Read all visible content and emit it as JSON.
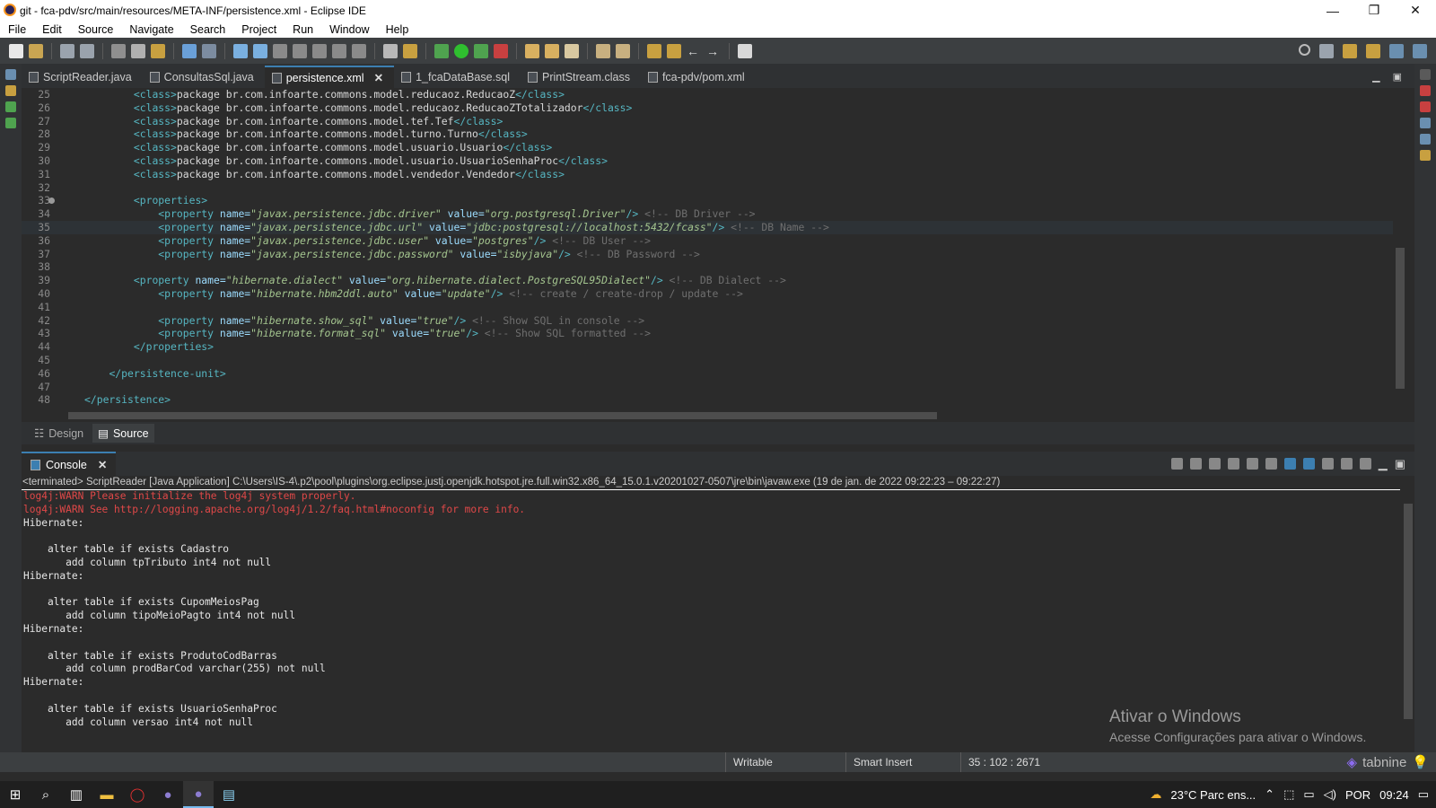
{
  "window": {
    "title": "git - fca-pdv/src/main/resources/META-INF/persistence.xml - Eclipse IDE"
  },
  "menu": [
    "File",
    "Edit",
    "Source",
    "Navigate",
    "Search",
    "Project",
    "Run",
    "Window",
    "Help"
  ],
  "editor_tabs": [
    {
      "label": "ScriptReader.java",
      "active": false
    },
    {
      "label": "ConsultasSql.java",
      "active": false
    },
    {
      "label": "persistence.xml",
      "active": true
    },
    {
      "label": "1_fcaDataBase.sql",
      "active": false
    },
    {
      "label": "PrintStream.class",
      "active": false
    },
    {
      "label": "fca-pdv/pom.xml",
      "active": false
    }
  ],
  "code_lines": [
    {
      "n": "25",
      "segs": [
        [
          "i",
          "        "
        ],
        [
          "tg",
          "<class>"
        ],
        [
          "tx",
          "package br.com.infoarte.commons.model.reducaoz.ReducaoZ"
        ],
        [
          "tg",
          "</class>"
        ]
      ]
    },
    {
      "n": "26",
      "segs": [
        [
          "i",
          "        "
        ],
        [
          "tg",
          "<class>"
        ],
        [
          "tx",
          "package br.com.infoarte.commons.model.reducaoz.ReducaoZTotalizador"
        ],
        [
          "tg",
          "</class>"
        ]
      ]
    },
    {
      "n": "27",
      "segs": [
        [
          "i",
          "        "
        ],
        [
          "tg",
          "<class>"
        ],
        [
          "tx",
          "package br.com.infoarte.commons.model.tef.Tef"
        ],
        [
          "tg",
          "</class>"
        ]
      ]
    },
    {
      "n": "28",
      "segs": [
        [
          "i",
          "        "
        ],
        [
          "tg",
          "<class>"
        ],
        [
          "tx",
          "package br.com.infoarte.commons.model.turno.Turno"
        ],
        [
          "tg",
          "</class>"
        ]
      ]
    },
    {
      "n": "29",
      "segs": [
        [
          "i",
          "        "
        ],
        [
          "tg",
          "<class>"
        ],
        [
          "tx",
          "package br.com.infoarte.commons.model.usuario.Usuario"
        ],
        [
          "tg",
          "</class>"
        ]
      ]
    },
    {
      "n": "30",
      "segs": [
        [
          "i",
          "        "
        ],
        [
          "tg",
          "<class>"
        ],
        [
          "tx",
          "package br.com.infoarte.commons.model.usuario.UsuarioSenhaProc"
        ],
        [
          "tg",
          "</class>"
        ]
      ]
    },
    {
      "n": "31",
      "segs": [
        [
          "i",
          "        "
        ],
        [
          "tg",
          "<class>"
        ],
        [
          "tx",
          "package br.com.infoarte.commons.model.vendedor.Vendedor"
        ],
        [
          "tg",
          "</class>"
        ]
      ]
    },
    {
      "n": "32",
      "segs": []
    },
    {
      "n": "33",
      "fold": true,
      "segs": [
        [
          "i",
          "        "
        ],
        [
          "tg",
          "<properties>"
        ]
      ]
    },
    {
      "n": "34",
      "segs": [
        [
          "i",
          "            "
        ],
        [
          "tg",
          "<property "
        ],
        [
          "at",
          "name="
        ],
        [
          "av",
          "\"javax.persistence.jdbc.driver\""
        ],
        [
          "at",
          " value="
        ],
        [
          "av",
          "\"org.postgresql.Driver\""
        ],
        [
          "tg",
          "/>"
        ],
        [
          "cm",
          " <!-- DB Driver -->"
        ]
      ]
    },
    {
      "n": "35",
      "cur": true,
      "segs": [
        [
          "i",
          "            "
        ],
        [
          "tg",
          "<property "
        ],
        [
          "at",
          "name="
        ],
        [
          "av",
          "\"javax.persistence.jdbc.url\""
        ],
        [
          "at",
          " value="
        ],
        [
          "av",
          "\"jdbc:postgresql://localhost:5432/fcass\""
        ],
        [
          "tg",
          "/>"
        ],
        [
          "cm",
          " <!-- DB Name -->"
        ]
      ]
    },
    {
      "n": "36",
      "segs": [
        [
          "i",
          "            "
        ],
        [
          "tg",
          "<property "
        ],
        [
          "at",
          "name="
        ],
        [
          "av",
          "\"javax.persistence.jdbc.user\""
        ],
        [
          "at",
          " value="
        ],
        [
          "av",
          "\"postgres\""
        ],
        [
          "tg",
          "/>"
        ],
        [
          "cm",
          " <!-- DB User -->"
        ]
      ]
    },
    {
      "n": "37",
      "segs": [
        [
          "i",
          "            "
        ],
        [
          "tg",
          "<property "
        ],
        [
          "at",
          "name="
        ],
        [
          "av",
          "\"javax.persistence.jdbc.password\""
        ],
        [
          "at",
          " value="
        ],
        [
          "av",
          "\"isbyjava\""
        ],
        [
          "tg",
          "/>"
        ],
        [
          "cm",
          " <!-- DB Password -->"
        ]
      ]
    },
    {
      "n": "38",
      "segs": []
    },
    {
      "n": "39",
      "segs": [
        [
          "i",
          "        "
        ],
        [
          "tg",
          "<property "
        ],
        [
          "at",
          "name="
        ],
        [
          "av",
          "\"hibernate.dialect\""
        ],
        [
          "at",
          " value="
        ],
        [
          "av",
          "\"org.hibernate.dialect.PostgreSQL95Dialect\""
        ],
        [
          "tg",
          "/>"
        ],
        [
          "cm",
          " <!-- DB Dialect -->"
        ]
      ]
    },
    {
      "n": "40",
      "segs": [
        [
          "i",
          "            "
        ],
        [
          "tg",
          "<property "
        ],
        [
          "at",
          "name="
        ],
        [
          "av",
          "\"hibernate.hbm2ddl.auto\""
        ],
        [
          "at",
          " value="
        ],
        [
          "av",
          "\"update\""
        ],
        [
          "tg",
          "/>"
        ],
        [
          "cm",
          " <!-- create / create-drop / update -->"
        ]
      ]
    },
    {
      "n": "41",
      "segs": []
    },
    {
      "n": "42",
      "segs": [
        [
          "i",
          "            "
        ],
        [
          "tg",
          "<property "
        ],
        [
          "at",
          "name="
        ],
        [
          "av",
          "\"hibernate.show_sql\""
        ],
        [
          "at",
          " value="
        ],
        [
          "av",
          "\"true\""
        ],
        [
          "tg",
          "/>"
        ],
        [
          "cm",
          " <!-- Show SQL in console -->"
        ]
      ]
    },
    {
      "n": "43",
      "segs": [
        [
          "i",
          "            "
        ],
        [
          "tg",
          "<property "
        ],
        [
          "at",
          "name="
        ],
        [
          "av",
          "\"hibernate.format_sql\""
        ],
        [
          "at",
          " value="
        ],
        [
          "av",
          "\"true\""
        ],
        [
          "tg",
          "/>"
        ],
        [
          "cm",
          " <!-- Show SQL formatted -->"
        ]
      ]
    },
    {
      "n": "44",
      "segs": [
        [
          "i",
          "        "
        ],
        [
          "tg",
          "</properties>"
        ]
      ]
    },
    {
      "n": "45",
      "segs": []
    },
    {
      "n": "46",
      "segs": [
        [
          "i",
          "    "
        ],
        [
          "tg",
          "</persistence-unit>"
        ]
      ]
    },
    {
      "n": "47",
      "segs": []
    },
    {
      "n": "48",
      "segs": [
        [
          "tg",
          "</persistence>"
        ]
      ]
    }
  ],
  "mode_tabs": [
    {
      "label": "Design",
      "active": false
    },
    {
      "label": "Source",
      "active": true
    }
  ],
  "console": {
    "tab_label": "Console",
    "status": "<terminated> ScriptReader [Java Application] C:\\Users\\IS-4\\.p2\\pool\\plugins\\org.eclipse.justj.openjdk.hotspot.jre.full.win32.x86_64_15.0.1.v20201027-0507\\jre\\bin\\javaw.exe  (19 de jan. de 2022 09:22:23 – 09:22:27)",
    "lines": [
      {
        "t": "log4j:WARN Please initialize the log4j system properly.",
        "err": true
      },
      {
        "t": "log4j:WARN See http://logging.apache.org/log4j/1.2/faq.html#noconfig for more info.",
        "err": true
      },
      {
        "t": "Hibernate: ",
        "err": false
      },
      {
        "t": "",
        "err": false
      },
      {
        "t": "    alter table if exists Cadastro ",
        "err": false
      },
      {
        "t": "       add column tpTributo int4 not null",
        "err": false
      },
      {
        "t": "Hibernate: ",
        "err": false
      },
      {
        "t": "",
        "err": false
      },
      {
        "t": "    alter table if exists CupomMeiosPag ",
        "err": false
      },
      {
        "t": "       add column tipoMeioPagto int4 not null",
        "err": false
      },
      {
        "t": "Hibernate: ",
        "err": false
      },
      {
        "t": "",
        "err": false
      },
      {
        "t": "    alter table if exists ProdutoCodBarras ",
        "err": false
      },
      {
        "t": "       add column prodBarCod varchar(255) not null",
        "err": false
      },
      {
        "t": "Hibernate: ",
        "err": false
      },
      {
        "t": "",
        "err": false
      },
      {
        "t": "    alter table if exists UsuarioSenhaProc ",
        "err": false
      },
      {
        "t": "       add column versao int4 not null",
        "err": false
      }
    ]
  },
  "watermark": {
    "line1": "Ativar o Windows",
    "line2": "Acesse Configurações para ativar o Windows."
  },
  "statusbar": {
    "writable": "Writable",
    "insert": "Smart Insert",
    "position": "35 : 102 : 2671",
    "tabnine": "tabnine"
  },
  "taskbar": {
    "weather": "23°C  Parc ens...",
    "lang": "POR",
    "time": "09:24"
  },
  "colors": {
    "tag": "#56b6c2",
    "attr": "#9cdcfe",
    "value": "#a4c58f",
    "comment": "#6f6f6f",
    "error": "#e04848",
    "accent": "#3c7fb1"
  }
}
